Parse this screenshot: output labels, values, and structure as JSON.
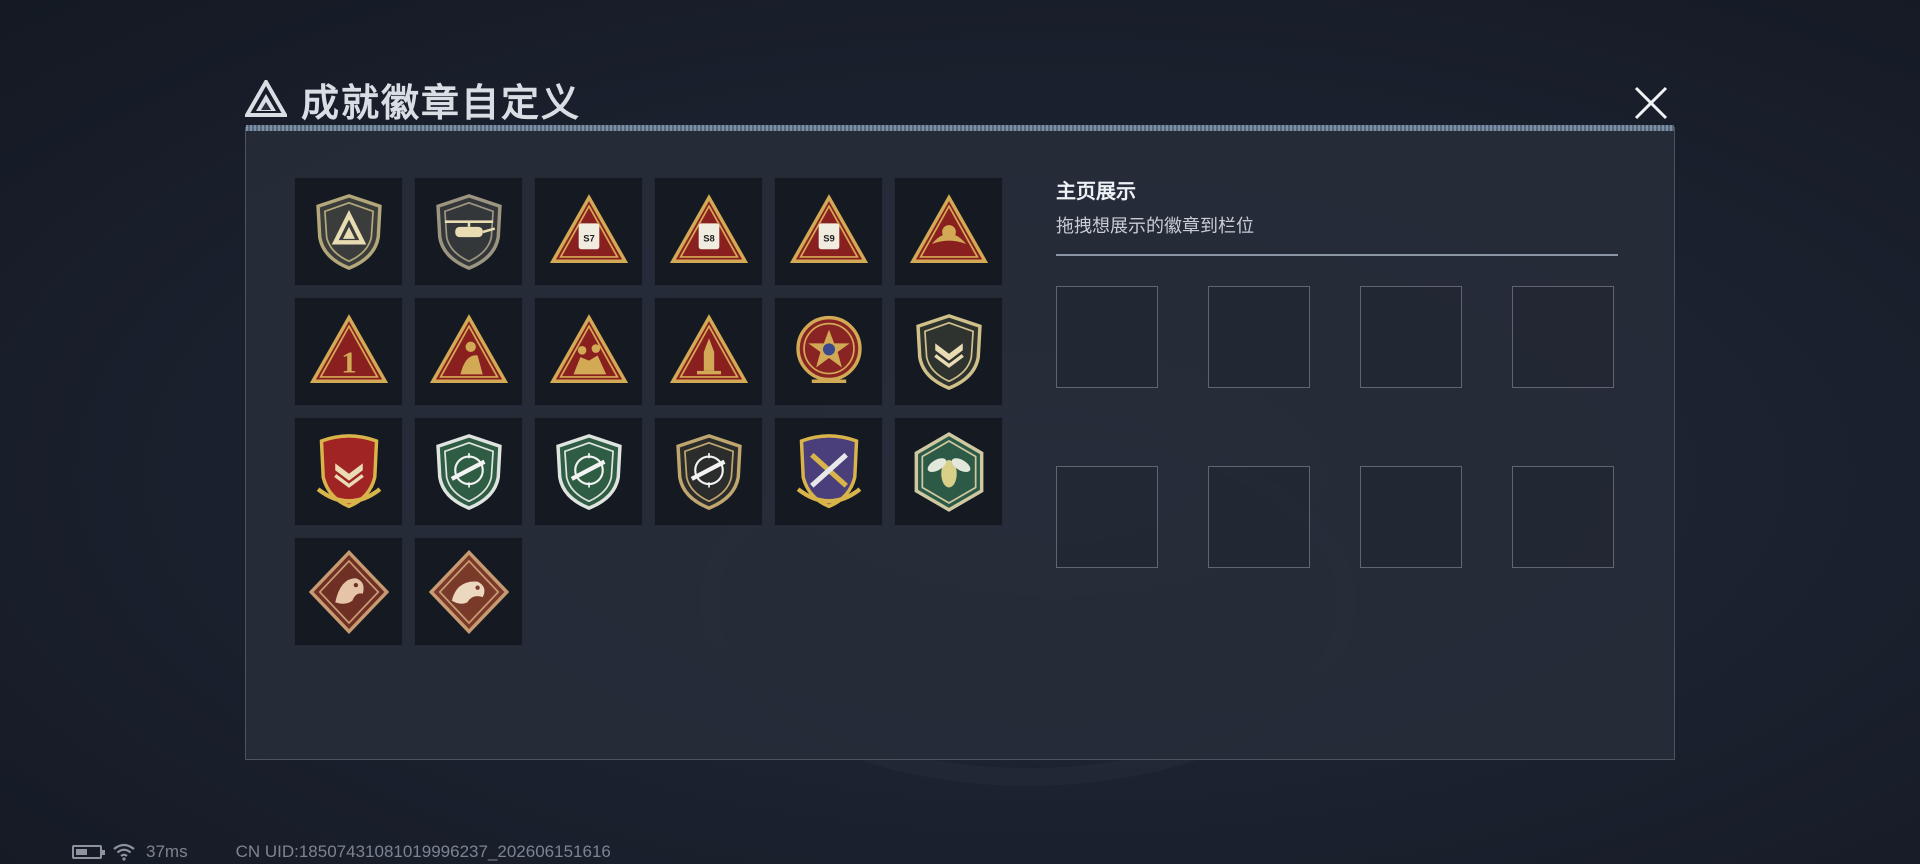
{
  "header": {
    "title": "成就徽章自定义"
  },
  "showcase": {
    "title": "主页展示",
    "subtitle": "拖拽想展示的徽章到栏位",
    "slot_count": 8
  },
  "badges": [
    {
      "icon": "shield-triangle-logo-badge",
      "shape": "shield",
      "fill": "#3a3d3c",
      "rim": "#b4a87a",
      "glyph": "logo"
    },
    {
      "icon": "helicopter-shield-badge",
      "shape": "shield",
      "fill": "#34373a",
      "rim": "#9c9582",
      "glyph": "heli"
    },
    {
      "icon": "s7-triangle-badge",
      "shape": "triangle",
      "fill": "#8a1f1f",
      "rim": "#d2aa55",
      "glyph": "S7"
    },
    {
      "icon": "s8-triangle-badge",
      "shape": "triangle",
      "fill": "#8a1f1f",
      "rim": "#d2aa55",
      "glyph": "S8"
    },
    {
      "icon": "s9-triangle-badge",
      "shape": "triangle",
      "fill": "#8a1f1f",
      "rim": "#d2aa55",
      "glyph": "S9"
    },
    {
      "icon": "eagle-triangle-badge",
      "shape": "triangle",
      "fill": "#8a1f1f",
      "rim": "#d2aa55",
      "glyph": "eagle"
    },
    {
      "icon": "number-one-triangle-badge",
      "shape": "triangle",
      "fill": "#8a1f1f",
      "rim": "#d2aa55",
      "glyph": "1"
    },
    {
      "icon": "soldier-triangle-badge",
      "shape": "triangle",
      "fill": "#8a1f1f",
      "rim": "#d2aa55",
      "glyph": "figure"
    },
    {
      "icon": "squad-triangle-badge",
      "shape": "triangle",
      "fill": "#8a1f1f",
      "rim": "#d2aa55",
      "glyph": "squad"
    },
    {
      "icon": "rocket-triangle-badge",
      "shape": "triangle",
      "fill": "#8a1f1f",
      "rim": "#d2aa55",
      "glyph": "rocket"
    },
    {
      "icon": "star-medal-badge",
      "shape": "medal",
      "fill": "#8a2323",
      "rim": "#d2aa55",
      "glyph": "star"
    },
    {
      "icon": "chevron-shield-badge",
      "shape": "shield",
      "fill": "#2e3330",
      "rim": "#d0c08a",
      "glyph": "chevron"
    },
    {
      "icon": "winged-shield-gold-badge",
      "shape": "crest",
      "fill": "#a02424",
      "rim": "#d9b44a",
      "glyph": "chevron"
    },
    {
      "icon": "rifle-crosshair-green-badge",
      "shape": "shield",
      "fill": "#2f5d44",
      "rim": "#e0e4e0",
      "glyph": "rifle"
    },
    {
      "icon": "rifle-crosshair-green-badge-2",
      "shape": "shield",
      "fill": "#2f5d44",
      "rim": "#e0e4e0",
      "glyph": "rifle"
    },
    {
      "icon": "rifle-crosshair-dark-badge",
      "shape": "shield",
      "fill": "#2a2d2c",
      "rim": "#c0a66e",
      "glyph": "rifle"
    },
    {
      "icon": "crossed-arms-purple-badge",
      "shape": "crest",
      "fill": "#4a3f7a",
      "rim": "#d9b44a",
      "glyph": "cross"
    },
    {
      "icon": "hornet-hexagon-badge",
      "shape": "hexagon",
      "fill": "#2c5a47",
      "rim": "#d0c8a0",
      "glyph": "hornet"
    },
    {
      "icon": "dragon-diamond-badge",
      "shape": "diamond",
      "fill": "#6e2f24",
      "rim": "#c89a72",
      "glyph": "dragon"
    },
    {
      "icon": "serpent-diamond-badge",
      "shape": "diamond",
      "fill": "#7a3a2a",
      "rim": "#c89a72",
      "glyph": "serpent"
    }
  ],
  "footer": {
    "battery_level": 0.5,
    "ping": "37ms",
    "uid": "CN UID:18507431081019996237_202606151616"
  },
  "colors": {
    "panel_bg": "#262c38",
    "accent": "#d2aa55",
    "text": "#e8ebf0"
  }
}
